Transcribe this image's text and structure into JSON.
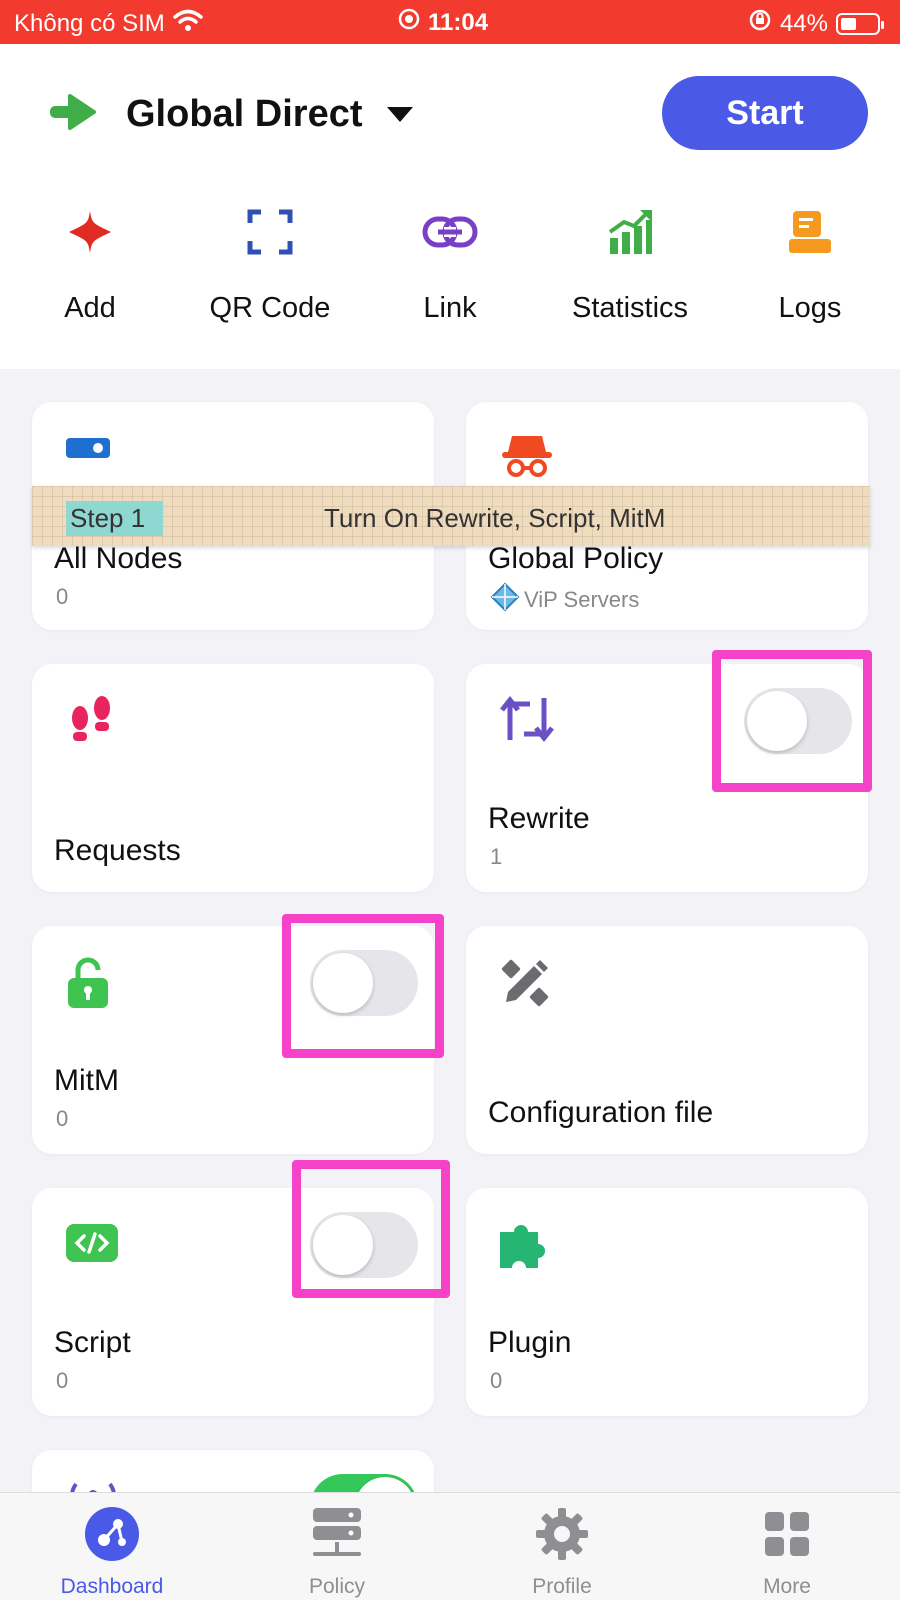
{
  "status_bar": {
    "carrier": "Không có SIM",
    "time": "11:04",
    "battery": "44%",
    "battery_level": 0.44
  },
  "header": {
    "policy_name": "Global Direct",
    "start_label": "Start"
  },
  "actions": [
    {
      "label": "Add",
      "icon": "plus-icon"
    },
    {
      "label": "QR Code",
      "icon": "qr-scan-icon"
    },
    {
      "label": "Link",
      "icon": "link-icon"
    },
    {
      "label": "Statistics",
      "icon": "chart-icon"
    },
    {
      "label": "Logs",
      "icon": "logs-icon"
    }
  ],
  "cards": {
    "all_nodes": {
      "title": "All Nodes",
      "sub": "0"
    },
    "global_policy": {
      "title": "Global Policy",
      "sub": "ViP Servers"
    },
    "requests": {
      "title": "Requests"
    },
    "rewrite": {
      "title": "Rewrite",
      "sub": "1",
      "enabled": false
    },
    "mitm": {
      "title": "MitM",
      "sub": "0",
      "enabled": false
    },
    "config": {
      "title": "Configuration file"
    },
    "script": {
      "title": "Script",
      "sub": "0",
      "enabled": false
    },
    "plugin": {
      "title": "Plugin",
      "sub": "0"
    },
    "partial": {
      "enabled": true
    }
  },
  "annotation": {
    "step": "Step 1",
    "text": "Turn On Rewrite, Script, MitM",
    "highlight_color": "#f542c8"
  },
  "tabs": [
    {
      "label": "Dashboard",
      "active": true
    },
    {
      "label": "Policy",
      "active": false
    },
    {
      "label": "Profile",
      "active": false
    },
    {
      "label": "More",
      "active": false
    }
  ],
  "colors": {
    "status_bar": "#f23a2e",
    "accent": "#4a5ae6",
    "toggle_on": "#34c759"
  }
}
